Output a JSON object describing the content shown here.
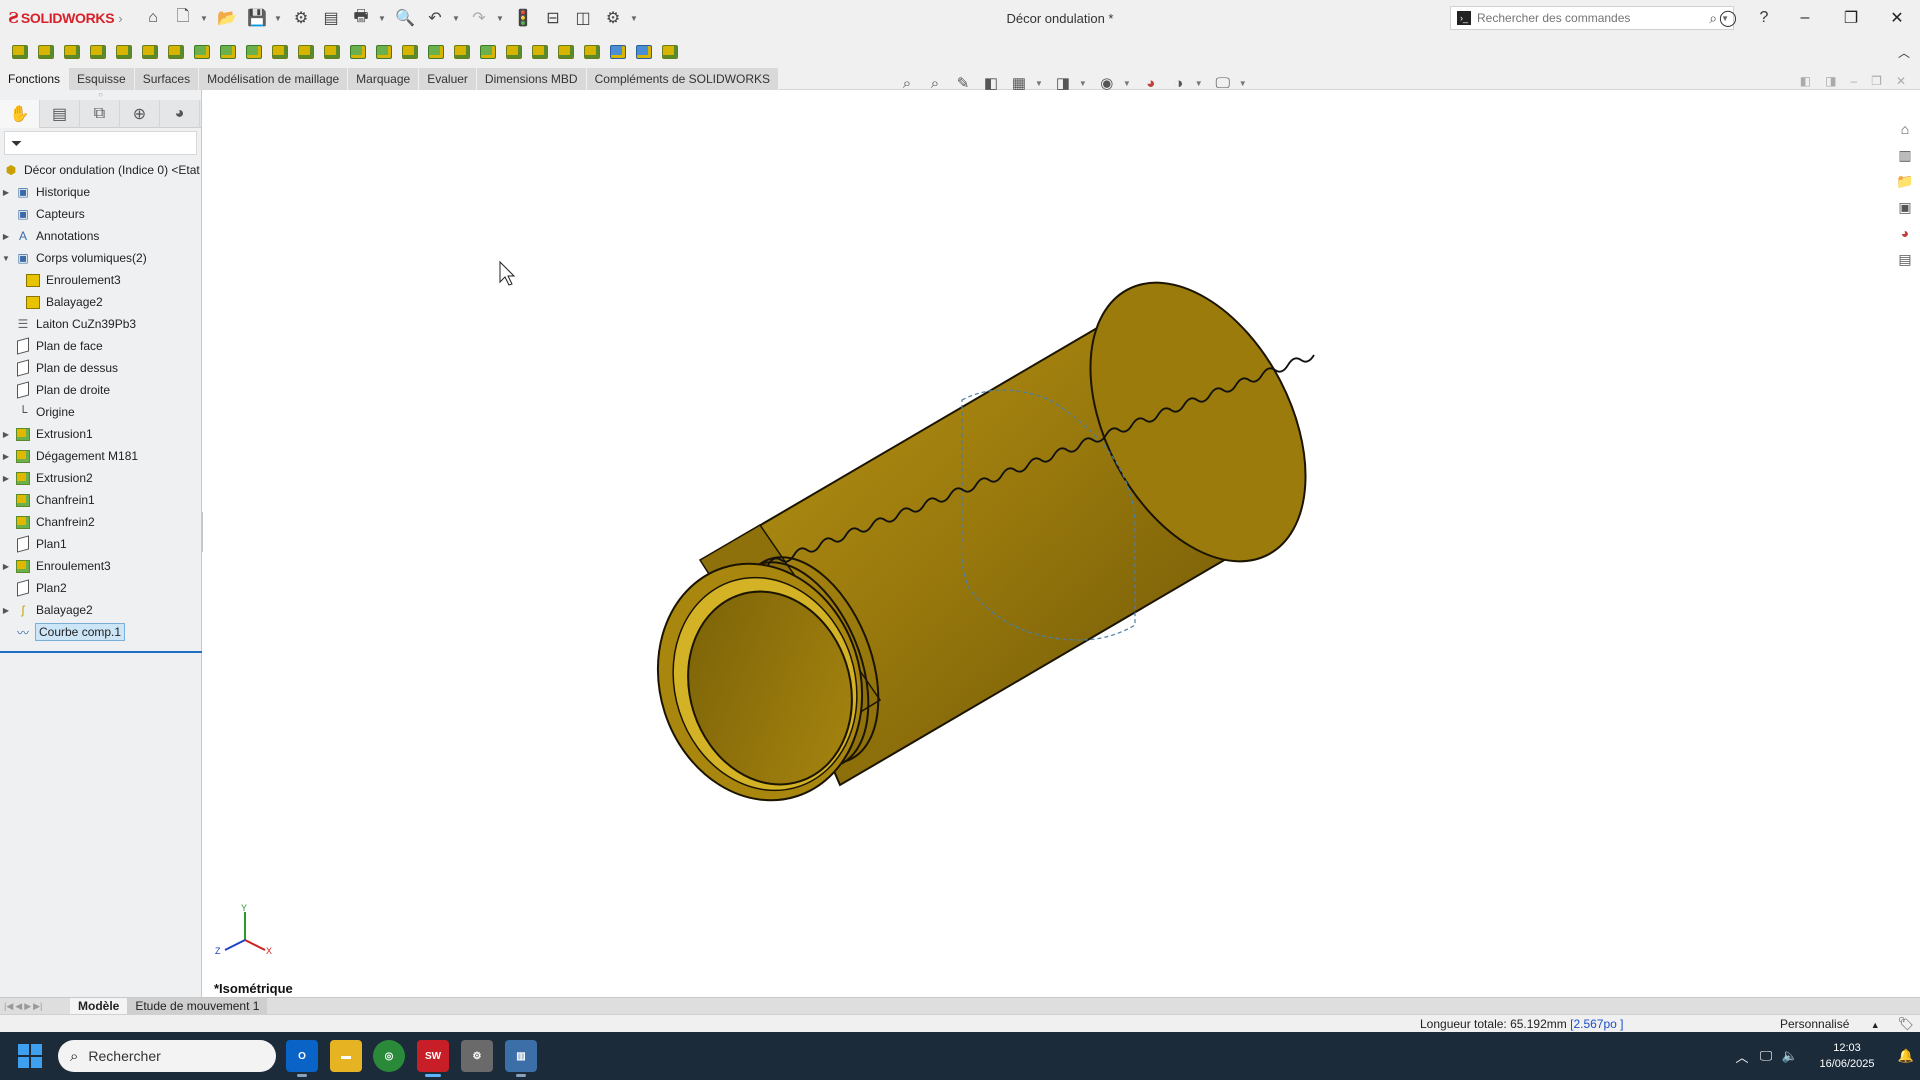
{
  "app": {
    "brand": "SOLIDWORKS",
    "doc_title": "Décor ondulation *"
  },
  "search": {
    "placeholder": "Rechercher des commandes"
  },
  "tabs": [
    {
      "label": "Fonctions",
      "active": true
    },
    {
      "label": "Esquisse"
    },
    {
      "label": "Surfaces"
    },
    {
      "label": "Modélisation de maillage"
    },
    {
      "label": "Marquage"
    },
    {
      "label": "Evaluer"
    },
    {
      "label": "Dimensions MBD"
    },
    {
      "label": "Compléments de SOLIDWORKS"
    }
  ],
  "tree": {
    "root": "Décor ondulation (Indice 0) <Etat",
    "items": [
      {
        "label": "Historique",
        "icon": "history-folder-icon",
        "expandable": true
      },
      {
        "label": "Capteurs",
        "icon": "sensor-icon",
        "expandable": false
      },
      {
        "label": "Annotations",
        "icon": "annotations-icon",
        "expandable": true
      },
      {
        "label": "Corps volumiques(2)",
        "icon": "solid-bodies-icon",
        "expandable": true,
        "expanded": true
      },
      {
        "label": "Enroulement3",
        "icon": "body-icon",
        "child": true
      },
      {
        "label": "Balayage2",
        "icon": "body-icon",
        "child": true
      },
      {
        "label": "Laiton CuZn39Pb3",
        "icon": "material-icon"
      },
      {
        "label": "Plan de face",
        "icon": "plane-icon"
      },
      {
        "label": "Plan de dessus",
        "icon": "plane-icon"
      },
      {
        "label": "Plan de droite",
        "icon": "plane-icon"
      },
      {
        "label": "Origine",
        "icon": "origin-icon"
      },
      {
        "label": "Extrusion1",
        "icon": "extrude-icon",
        "expandable": true
      },
      {
        "label": "Dégagement M181",
        "icon": "hole-wizard-icon",
        "expandable": true
      },
      {
        "label": "Extrusion2",
        "icon": "extrude-icon",
        "expandable": true
      },
      {
        "label": "Chanfrein1",
        "icon": "chamfer-icon"
      },
      {
        "label": "Chanfrein2",
        "icon": "chamfer-icon"
      },
      {
        "label": "Plan1",
        "icon": "plane-icon"
      },
      {
        "label": "Enroulement3",
        "icon": "wrap-icon",
        "expandable": true
      },
      {
        "label": "Plan2",
        "icon": "plane-icon"
      },
      {
        "label": "Balayage2",
        "icon": "sweep-icon",
        "expandable": true
      },
      {
        "label": "Courbe comp.1",
        "icon": "composite-curve-icon",
        "selected": true
      }
    ]
  },
  "viewport": {
    "view_name": "*Isométrique",
    "triad": {
      "x": "X",
      "y": "Y",
      "z": "Z"
    }
  },
  "model_tabs": [
    {
      "label": "Modèle",
      "active": true
    },
    {
      "label": "Etude de mouvement 1"
    }
  ],
  "status": {
    "measure": "Longueur totale: 65.192mm",
    "measure_alt": "[2.567po ]",
    "units": "Personnalisé"
  },
  "taskbar": {
    "search_label": "Rechercher",
    "time": "12:03",
    "date": "16/06/2025"
  },
  "colors": {
    "part_gold": "#a88510",
    "selection_blue": "#1f6fc4",
    "brand_red": "#d8202a"
  }
}
